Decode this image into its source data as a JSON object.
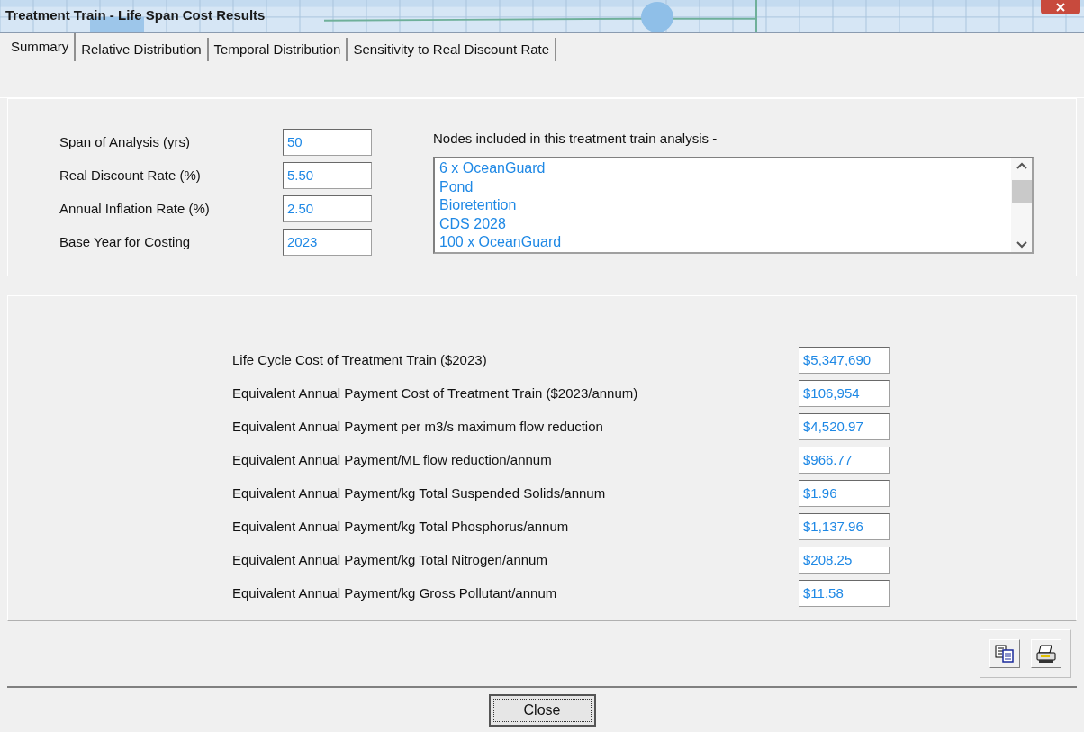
{
  "window": {
    "title": "Treatment Train - Life Span Cost Results"
  },
  "tabs": [
    {
      "label": "Summary",
      "selected": true
    },
    {
      "label": "Relative Distribution",
      "selected": false
    },
    {
      "label": "Temporal Distribution",
      "selected": false
    },
    {
      "label": "Sensitivity to Real Discount Rate",
      "selected": false
    }
  ],
  "parameters": [
    {
      "label": "Span of Analysis (yrs)",
      "value": "50"
    },
    {
      "label": "Real Discount Rate (%)",
      "value": "5.50"
    },
    {
      "label": "Annual Inflation Rate (%)",
      "value": "2.50"
    },
    {
      "label": "Base Year for Costing",
      "value": "2023"
    }
  ],
  "nodes": {
    "label": "Nodes included in this treatment train analysis -",
    "items": [
      "6 x OceanGuard",
      "Pond",
      "Bioretention",
      "CDS 2028",
      "100 x OceanGuard"
    ]
  },
  "results": [
    {
      "label": "Life Cycle Cost of Treatment Train ($2023)",
      "value": "$5,347,690"
    },
    {
      "label": "Equivalent Annual Payment Cost of Treatment Train ($2023/annum)",
      "value": "$106,954"
    },
    {
      "label": "Equivalent Annual Payment per m3/s maximum flow reduction",
      "value": "$4,520.97"
    },
    {
      "label": "Equivalent Annual Payment/ML flow reduction/annum",
      "value": "$966.77"
    },
    {
      "label": "Equivalent Annual Payment/kg Total Suspended Solids/annum",
      "value": "$1.96"
    },
    {
      "label": "Equivalent Annual Payment/kg Total Phosphorus/annum",
      "value": "$1,137.96"
    },
    {
      "label": "Equivalent Annual Payment/kg Total Nitrogen/annum",
      "value": "$208.25"
    },
    {
      "label": "Equivalent Annual Payment/kg Gross Pollutant/annum",
      "value": "$11.58"
    }
  ],
  "close_button": "Close"
}
